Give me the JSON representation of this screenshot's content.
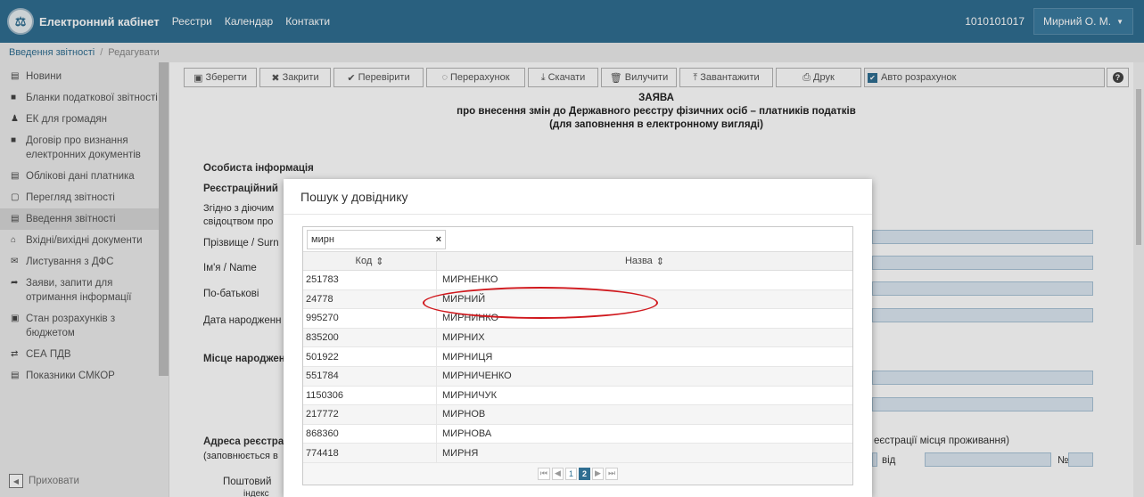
{
  "navbar": {
    "logo_glyph": "⚖",
    "brand": "Електронний кабінет",
    "links": [
      "Реєстри",
      "Календар",
      "Контакти"
    ],
    "code": "1010101017",
    "user": "Мирний О. М."
  },
  "breadcrumb": {
    "first": "Введення звітності",
    "second": "Редагувати"
  },
  "sidebar": {
    "items": [
      {
        "icon": "▤",
        "label": "Новини"
      },
      {
        "icon": "■",
        "label": "Бланки податкової звітності"
      },
      {
        "icon": "♟",
        "label": "ЕК для громадян"
      },
      {
        "icon": "■",
        "label": "Договір про визнання електронних документів"
      },
      {
        "icon": "▤",
        "label": "Облікові дані платника"
      },
      {
        "icon": "▢",
        "label": "Перегляд звітності"
      },
      {
        "icon": "▤",
        "label": "Введення звітності"
      },
      {
        "icon": "⌂",
        "label": "Вхідні/вихідні документи"
      },
      {
        "icon": "✉",
        "label": "Листування з ДФС"
      },
      {
        "icon": "➦",
        "label": "Заяви, запити для отримання інформації"
      },
      {
        "icon": "▣",
        "label": "Стан розрахунків з бюджетом"
      },
      {
        "icon": "⇄",
        "label": "СЕА ПДВ"
      },
      {
        "icon": "▤",
        "label": "Показники СМКОР"
      }
    ],
    "hide_label": "Приховати"
  },
  "toolbar": {
    "buttons": [
      {
        "icon": "▣",
        "label": "Зберегти"
      },
      {
        "icon": "✖",
        "label": "Закрити"
      },
      {
        "icon": "✔",
        "label": "Перевірити"
      },
      {
        "icon": "◌",
        "label": "Перерахунок"
      },
      {
        "icon": "⤓",
        "label": "Скачати"
      },
      {
        "icon": "🗑",
        "label": "Вилучити"
      },
      {
        "icon": "⤒",
        "label": "Завантажити"
      },
      {
        "icon": "⎙",
        "label": "Друк"
      }
    ],
    "auto_calc": "Авто розрахунок",
    "help": "?"
  },
  "form": {
    "title_line1": "ЗАЯВА",
    "title_line2": "про внесення змін до Державного реєстру фізичних осіб – платників податків",
    "title_line3": "(для заповнення в електронному вигляді)",
    "section_personal": "Особиста інформація",
    "reg_label": "Реєстраційний",
    "note_line1": "Згідно з діючим",
    "note_line2": "свідоцтвом про",
    "surname": "Прізвище / Surn",
    "name": "Ім'я / Name",
    "patronymic": "По-батькові",
    "birth_date": "Дата народженн",
    "birth_place": "Місце народжен",
    "address_label": "Адреса реєстра",
    "address_note": "(заповнюється в",
    "residence_note": "еєстрації місця проживання)",
    "vid_label": "від",
    "no_label": "№",
    "postal_label": "Поштовий",
    "postal_label2": "індекс"
  },
  "modal": {
    "title": "Пошук у довіднику",
    "search_value": "мирн",
    "clear_glyph": "×",
    "col_code": "Код",
    "col_name": "Назва",
    "sort_glyph": "⇕",
    "rows": [
      {
        "code": "251783",
        "name": "МИРНЕНКО"
      },
      {
        "code": "24778",
        "name": "МИРНИЙ"
      },
      {
        "code": "995270",
        "name": "МИРНИНКО"
      },
      {
        "code": "835200",
        "name": "МИРНИХ"
      },
      {
        "code": "501922",
        "name": "МИРНИЦЯ"
      },
      {
        "code": "551784",
        "name": "МИРНИЧЕНКО"
      },
      {
        "code": "1150306",
        "name": "МИРНИЧУК"
      },
      {
        "code": "217772",
        "name": "МИРНОВ"
      },
      {
        "code": "868360",
        "name": "МИРНОВА"
      },
      {
        "code": "774418",
        "name": "МИРНЯ"
      }
    ],
    "pager": {
      "first": "⏮",
      "prev": "◀",
      "page1": "1",
      "page2": "2",
      "next": "▶",
      "last": "⏭"
    }
  },
  "colors": {
    "navbar": "#2f6e91",
    "highlight_ellipse": "#d0181d",
    "input_fill": "#dce8f2"
  }
}
